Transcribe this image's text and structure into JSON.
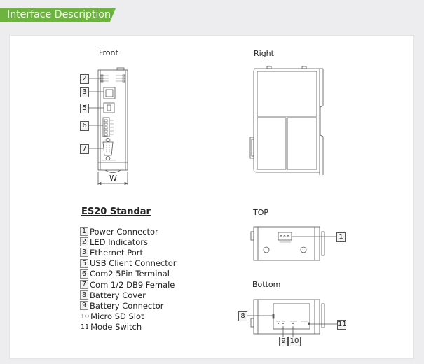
{
  "header": {
    "title": "Interface Description",
    "accent_color": "#6cb33f"
  },
  "views": {
    "front": {
      "title": "Front",
      "callouts": [
        "2",
        "3",
        "5",
        "6",
        "7"
      ],
      "dimension_label": "W"
    },
    "right": {
      "title": "Right"
    },
    "top": {
      "title": "TOP",
      "callouts": [
        "1"
      ]
    },
    "bottom": {
      "title": "Bottom",
      "callouts": [
        "8",
        "11",
        "9",
        "10"
      ]
    }
  },
  "legend": {
    "title": "ES20 Standar",
    "items": [
      {
        "num": "1",
        "label": "Power Connector"
      },
      {
        "num": "2",
        "label": "LED Indicators"
      },
      {
        "num": "3",
        "label": "Ethernet Port"
      },
      {
        "num": "5",
        "label": "USB Client Connector"
      },
      {
        "num": "6",
        "label": "Com2 5Pin Terminal"
      },
      {
        "num": "7",
        "label": "Com 1/2 DB9 Female"
      },
      {
        "num": "8",
        "label": "Battery Cover"
      },
      {
        "num": "9",
        "label": "Battery Connector"
      },
      {
        "num": "10",
        "label": "Micro SD Slot"
      },
      {
        "num": "11",
        "label": "Mode Switch"
      }
    ]
  }
}
